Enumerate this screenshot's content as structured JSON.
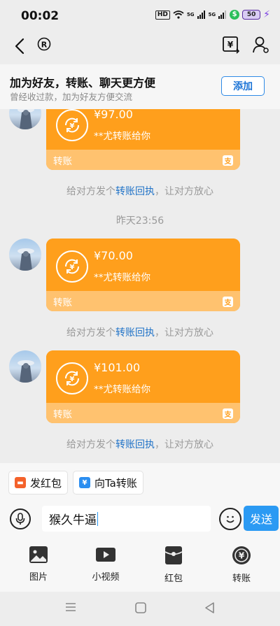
{
  "status_bar": {
    "time": "00:02",
    "hd": "HD",
    "sig1": "5G",
    "sig2": "5G",
    "battery": "50"
  },
  "banner": {
    "title": "加为好友，转账、聊天更方便",
    "subtitle": "曾经收过款，加为好友方便交流",
    "add_label": "添加"
  },
  "messages": [
    {
      "amount": "¥97.00",
      "from": "**尤转账给你",
      "type_label": "转账"
    },
    {
      "amount": "¥70.00",
      "from": "**尤转账给你",
      "type_label": "转账"
    },
    {
      "amount": "¥101.00",
      "from": "**尤转账给你",
      "type_label": "转账"
    }
  ],
  "hint": {
    "prefix": "给对方发个",
    "link": "转账回执",
    "suffix": "，让对方放心"
  },
  "timestamp": "昨天23:56",
  "quick_actions": [
    {
      "label": "发红包"
    },
    {
      "label": "向Ta转账"
    }
  ],
  "input": {
    "value": "猴久牛逼"
  },
  "send_label": "发送",
  "toolbar": [
    {
      "label": "图片",
      "icon": "image-icon"
    },
    {
      "label": "小视频",
      "icon": "video-icon"
    },
    {
      "label": "红包",
      "icon": "red-packet-icon"
    },
    {
      "label": "转账",
      "icon": "transfer-icon"
    }
  ],
  "colors": {
    "card": "#ff9f1c",
    "card_bottom": "#ffc26f",
    "link": "#1f72c7",
    "send": "#2b9af3"
  }
}
